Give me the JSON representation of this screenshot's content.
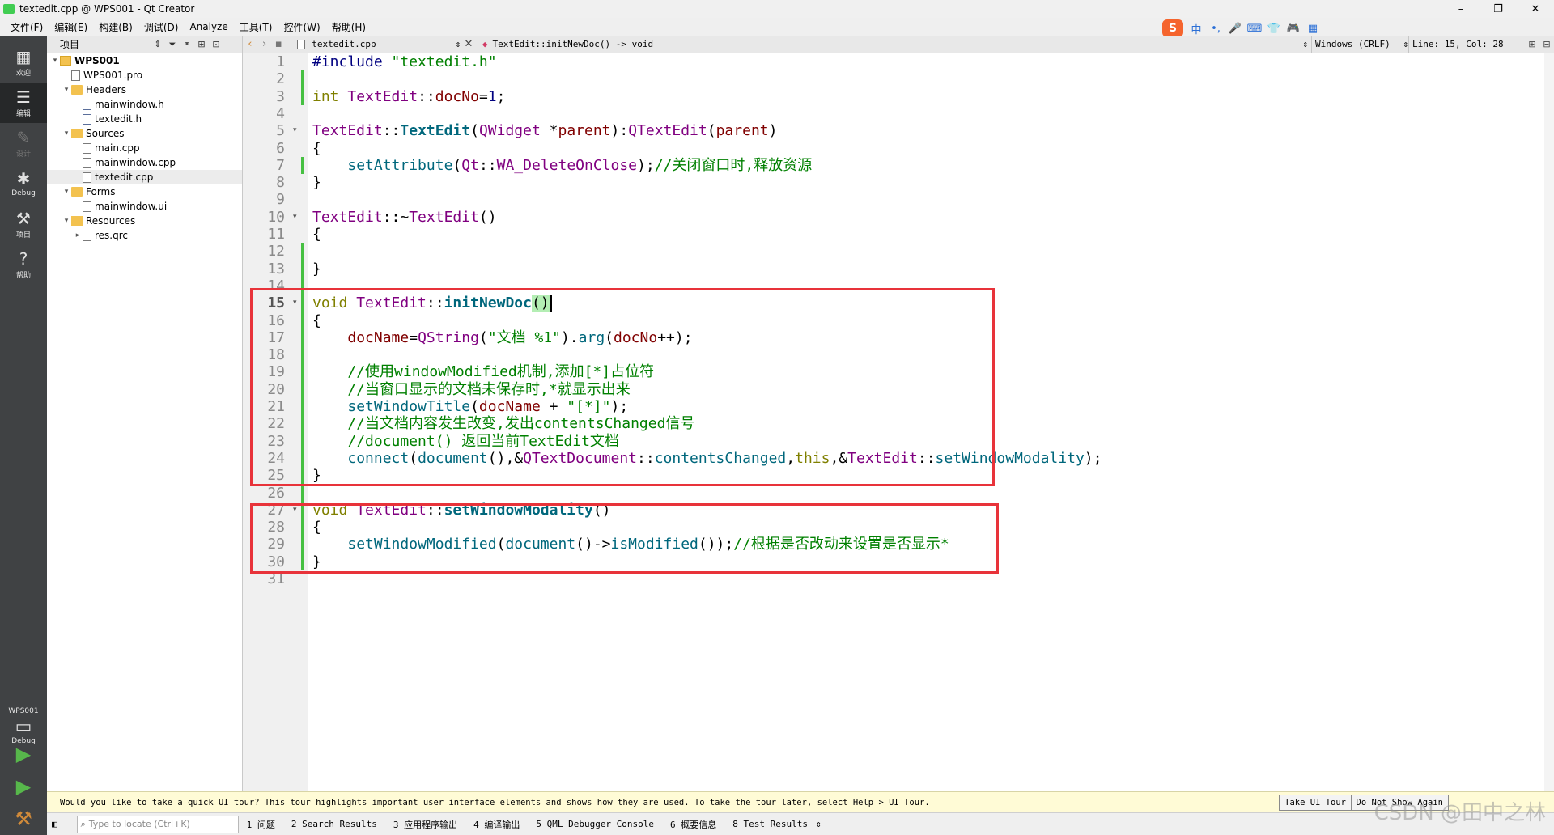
{
  "window": {
    "title": "textedit.cpp @ WPS001 - Qt Creator",
    "buttons": [
      "–",
      "❐",
      "✕"
    ]
  },
  "menubar": [
    "文件(F)",
    "编辑(E)",
    "构建(B)",
    "调试(D)",
    "Analyze",
    "工具(T)",
    "控件(W)",
    "帮助(H)"
  ],
  "ime": {
    "logo": "S",
    "items": [
      "中",
      "•,",
      "🎤",
      "⌨",
      "👕",
      "🎮",
      "▦"
    ]
  },
  "modes": [
    {
      "label": "欢迎",
      "icon": "grid-icon"
    },
    {
      "label": "编辑",
      "icon": "edit-doc-icon"
    },
    {
      "label": "设计",
      "icon": "pencil-icon"
    },
    {
      "label": "Debug",
      "icon": "bug-icon"
    },
    {
      "label": "项目",
      "icon": "wrench-icon"
    },
    {
      "label": "帮助",
      "icon": "help-icon"
    }
  ],
  "kit": {
    "project": "WPS001",
    "config": "Debug"
  },
  "project_panel": {
    "title": "项目",
    "tree": [
      {
        "label": "WPS001",
        "level": 0,
        "type": "project",
        "expanded": true
      },
      {
        "label": "WPS001.pro",
        "level": 1,
        "type": "file"
      },
      {
        "label": "Headers",
        "level": 1,
        "type": "folder",
        "expanded": true
      },
      {
        "label": "mainwindow.h",
        "level": 2,
        "type": "hfile"
      },
      {
        "label": "textedit.h",
        "level": 2,
        "type": "hfile"
      },
      {
        "label": "Sources",
        "level": 1,
        "type": "folder",
        "expanded": true
      },
      {
        "label": "main.cpp",
        "level": 2,
        "type": "file"
      },
      {
        "label": "mainwindow.cpp",
        "level": 2,
        "type": "file"
      },
      {
        "label": "textedit.cpp",
        "level": 2,
        "type": "file",
        "selected": true
      },
      {
        "label": "Forms",
        "level": 1,
        "type": "folder",
        "expanded": true
      },
      {
        "label": "mainwindow.ui",
        "level": 2,
        "type": "file"
      },
      {
        "label": "Resources",
        "level": 1,
        "type": "lock",
        "expanded": true
      },
      {
        "label": "res.qrc",
        "level": 2,
        "type": "file",
        "collapsed": true
      }
    ]
  },
  "editor_toolbar": {
    "document": "textedit.cpp",
    "symbol": "TextEdit::initNewDoc() -> void",
    "line_ending": "Windows (CRLF)",
    "cursor": "Line: 15, Col: 28"
  },
  "code": {
    "current_line": 15,
    "fold_lines": [
      5,
      10,
      15,
      27
    ],
    "lines": [
      "#include \"textedit.h\"",
      "",
      "int TextEdit::docNo=1;",
      "",
      "TextEdit::TextEdit(QWidget *parent):QTextEdit(parent)",
      "{",
      "    setAttribute(Qt::WA_DeleteOnClose);//关闭窗口时,释放资源",
      "}",
      "",
      "TextEdit::~TextEdit()",
      "{",
      "",
      "}",
      "",
      "void TextEdit::initNewDoc()",
      "{",
      "    docName=QString(\"文档 %1\").arg(docNo++);",
      "",
      "    //使用windowModified机制,添加[*]占位符",
      "    //当窗口显示的文档未保存时,*就显示出来",
      "    setWindowTitle(docName + \"[*]\");",
      "    //当文档内容发生改变,发出contentsChanged信号",
      "    //document() 返回当前TextEdit文档",
      "    connect(document(),&QTextDocument::contentsChanged,this,&TextEdit::setWindowModality);",
      "}",
      "",
      "void TextEdit::setWindowModality()",
      "{",
      "    setWindowModified(document()->isModified());//根据是否改动来设置是否显示*",
      "}",
      ""
    ]
  },
  "tour_bar": {
    "message": "Would you like to take a quick UI tour? This tour highlights important user interface elements and shows how they are used. To take the tour later, select Help > UI Tour.",
    "take_tour": "Take UI Tour",
    "dont_show": "Do Not Show Again"
  },
  "statusbar": {
    "locate_placeholder": "Type to locate (Ctrl+K)",
    "tabs": [
      "1 问题",
      "2 Search Results",
      "3 应用程序输出",
      "4 编译输出",
      "5 QML Debugger Console",
      "6 概要信息",
      "8 Test Results"
    ]
  },
  "watermark": "CSDN @田中之林",
  "colors": {
    "highlight_box": "#e8333a",
    "modebar": "#404244",
    "keyword": "#808000",
    "type": "#800080",
    "function": "#00677c"
  }
}
